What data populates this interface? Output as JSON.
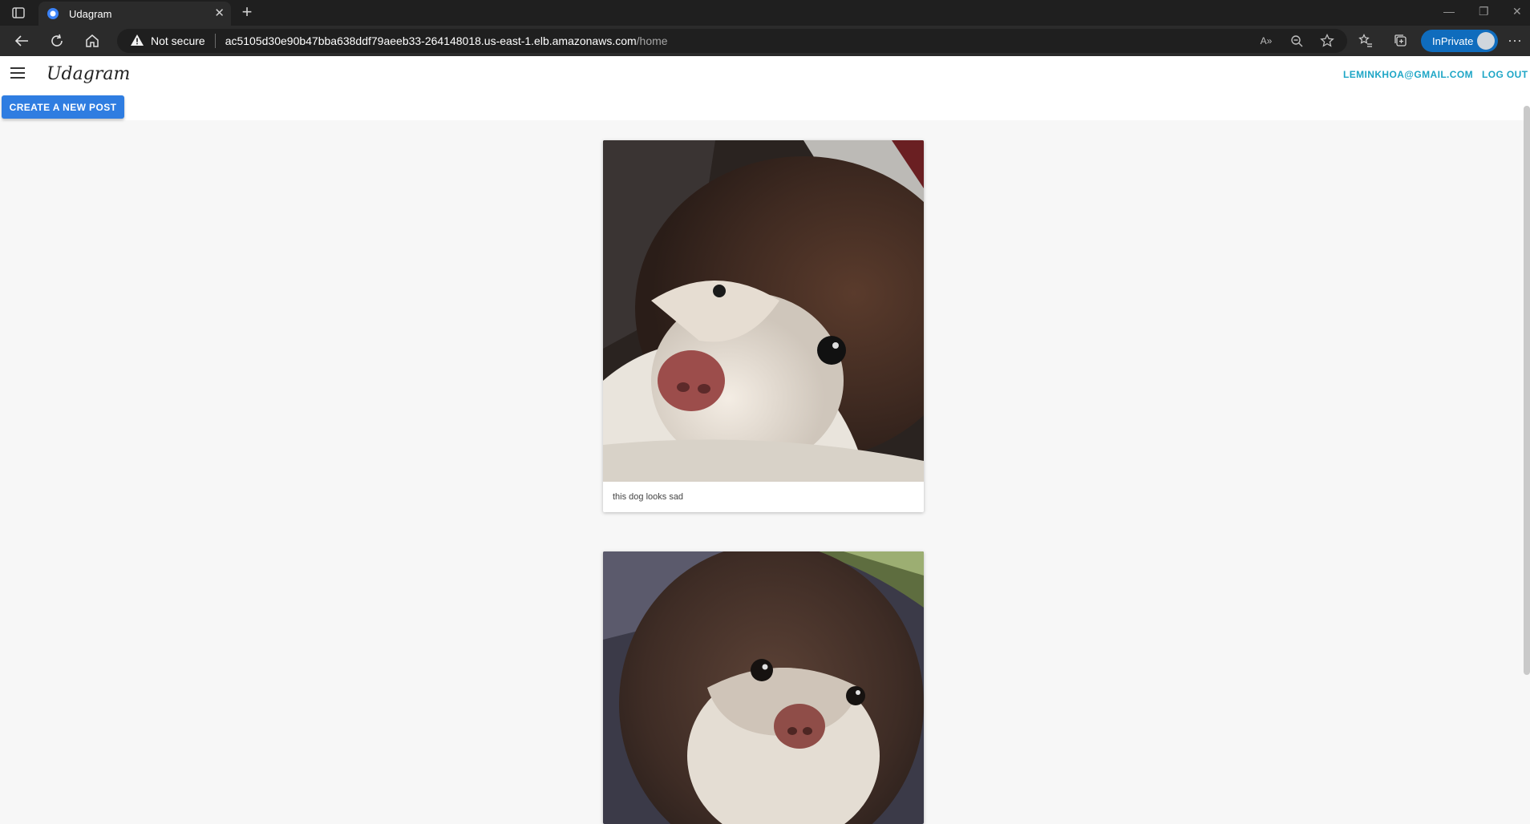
{
  "browser": {
    "tab_title": "Udagram",
    "security_label": "Not secure",
    "url_host": "ac5105d30e90b47bba638ddf79aeeb33-264148018.us-east-1.elb.amazonaws.com",
    "url_path": "/home",
    "inprivate_label": "InPrivate"
  },
  "app": {
    "logo": "Udagram",
    "user_email": "LEMINKHOA@GMAIL.COM",
    "logout_label": "LOG OUT",
    "create_post_label": "CREATE A NEW POST",
    "accent_color": "#2f7de1",
    "link_color": "#1ea6c6"
  },
  "feed": {
    "posts": [
      {
        "caption": "this dog looks sad",
        "image": "dog-closeup-lying-photo"
      },
      {
        "caption": "",
        "image": "dog-closeup-looking-up-photo"
      }
    ]
  }
}
